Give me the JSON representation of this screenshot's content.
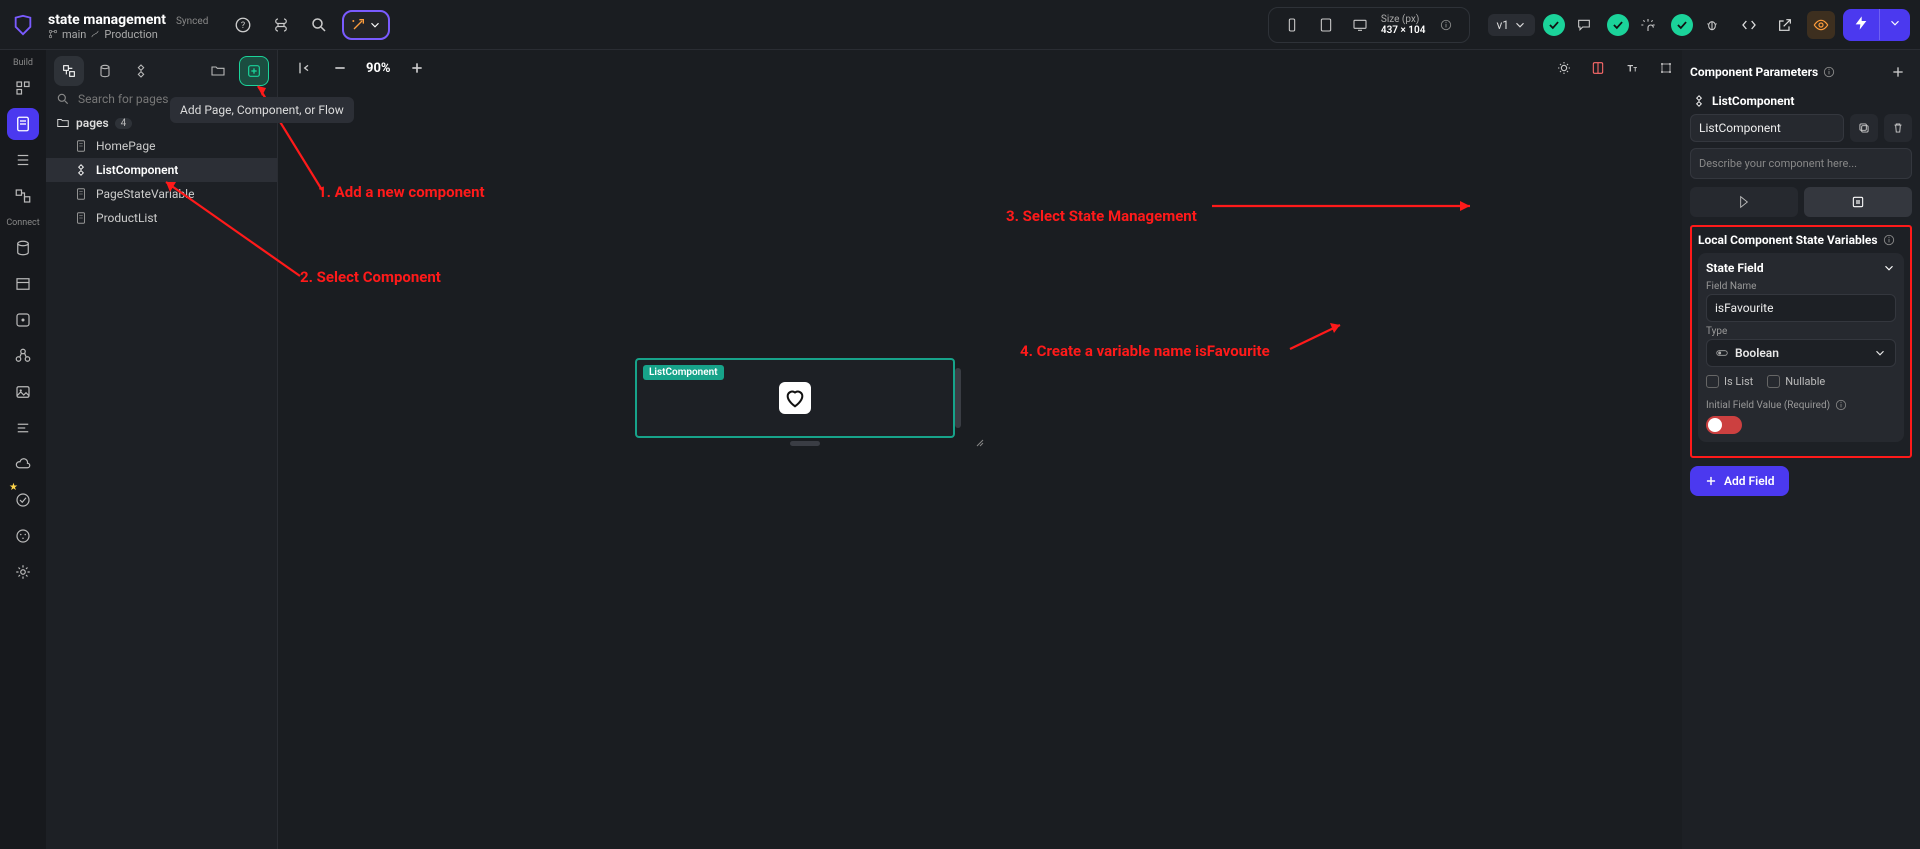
{
  "topbar": {
    "project_name": "state management",
    "sync_status": "Synced",
    "branch": "main",
    "env": "Production",
    "version": "v1",
    "size_label": "Size (px)",
    "size_value": "437 × 104"
  },
  "tooltip": "Add Page, Component, or Flow",
  "search_placeholder": "Search for pages",
  "pages_label": "pages",
  "pages_count": "4",
  "pages": [
    {
      "name": "HomePage",
      "type": "page"
    },
    {
      "name": "ListComponent",
      "type": "component"
    },
    {
      "name": "PageStateVariable",
      "type": "page"
    },
    {
      "name": "ProductList",
      "type": "page"
    }
  ],
  "zoom": "90%",
  "canvas_component_label": "ListComponent",
  "rightpanel": {
    "header": "Component Parameters",
    "component_name": "ListComponent",
    "name_value": "ListComponent",
    "desc_placeholder": "Describe your component here...",
    "state_section": "Local Component State Variables",
    "card_title": "State Field",
    "field_name_label": "Field Name",
    "field_name_value": "isFavourite",
    "type_label": "Type",
    "type_value": "Boolean",
    "is_list": "Is List",
    "nullable": "Nullable",
    "initial_label": "Initial Field Value (Required)",
    "add_field": "Add Field"
  },
  "annotations": {
    "a1": "1. Add a new component",
    "a2": "2. Select Component",
    "a3": "3. Select State Management",
    "a4": "4. Create a variable name isFavourite"
  }
}
